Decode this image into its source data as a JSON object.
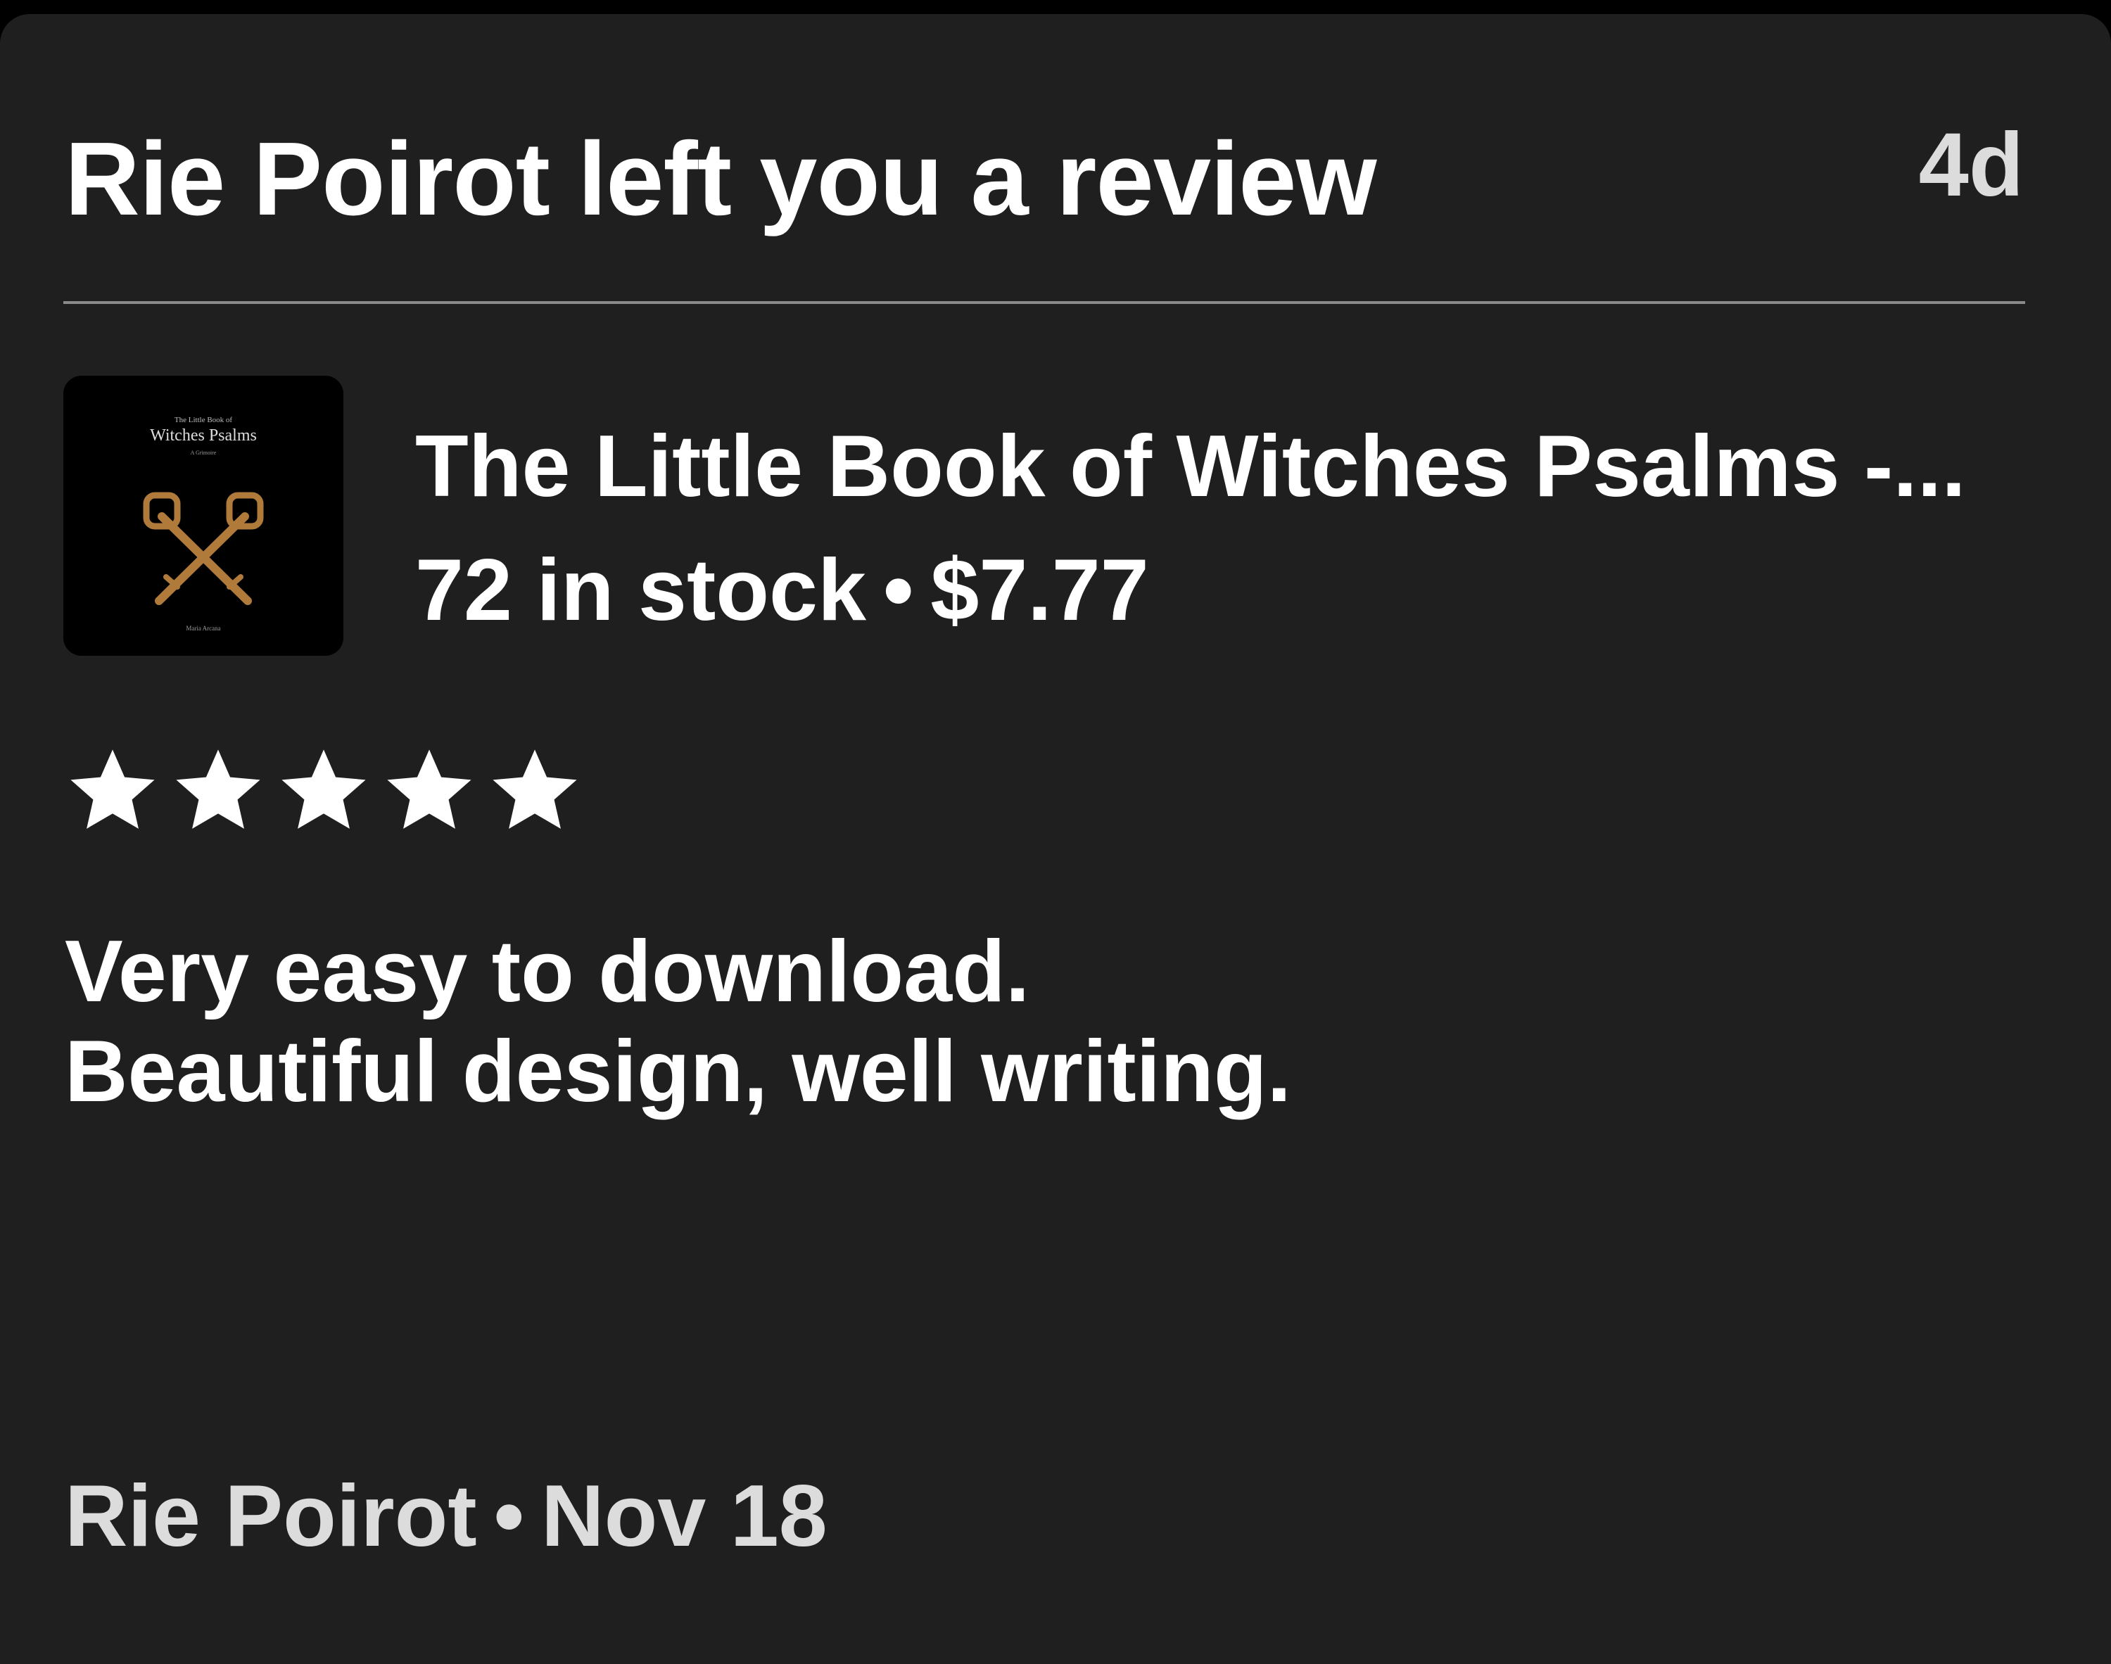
{
  "notification": {
    "title": "Rie Poirot left you a review",
    "age": "4d"
  },
  "product": {
    "title": "The Little Book of Witches Psalms -...",
    "stock": "72 in stock",
    "separator": "•",
    "price": "$7.77",
    "cover": {
      "top_text": "The Little Book of",
      "title_text": "Witches Psalms",
      "subtitle_text": "A Grimoire",
      "author_text": "Maria Arcana",
      "icon": "crossed-keys-icon",
      "key_color": "#b07a3a"
    }
  },
  "review": {
    "rating": 5,
    "rating_max": 5,
    "lines": [
      "Very easy to download.",
      "Beautiful design, well writing."
    ]
  },
  "footer": {
    "reviewer": "Rie Poirot",
    "separator": "•",
    "date": "Nov 18"
  },
  "colors": {
    "background": "#000000",
    "card": "#1f1f1f",
    "text": "#ffffff",
    "muted_text": "#dcdcdc",
    "divider": "#8a8a8a"
  }
}
